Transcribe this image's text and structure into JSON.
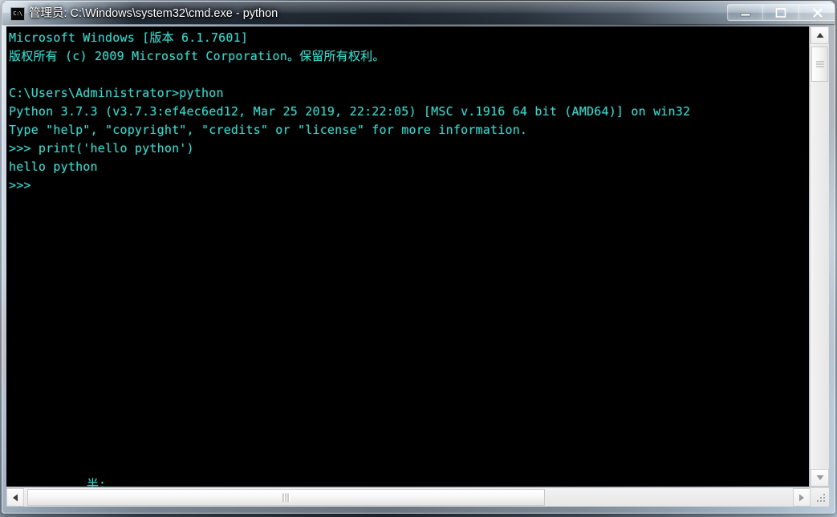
{
  "window": {
    "title": "管理员: C:\\Windows\\system32\\cmd.exe - python",
    "icon_label": "C:\\",
    "icon_name": "cmd-console-icon",
    "controls": {
      "minimize_label": "最小化",
      "maximize_label": "最大化",
      "close_label": "关闭"
    }
  },
  "console": {
    "background_color": "#000000",
    "text_color": "#3ad2c8",
    "lines": [
      "Microsoft Windows [版本 6.1.7601]",
      "版权所有 (c) 2009 Microsoft Corporation。保留所有权利。",
      "",
      "C:\\Users\\Administrator>python",
      "Python 3.7.3 (v3.7.3:ef4ec6ed12, Mar 25 2019, 22:22:05) [MSC v.1916 64 bit (AMD64)] on win32",
      "Type \"help\", \"copyright\", \"credits\" or \"license\" for more information.",
      ">>> print('hello python')",
      "hello python",
      ">>>"
    ],
    "bottom_text": "半:"
  },
  "scrollbars": {
    "vertical": {
      "up_arrow": "▲",
      "down_arrow": "▼",
      "thumb_grip": "grip-lines"
    },
    "horizontal": {
      "left_arrow": "◀",
      "right_arrow": "▶",
      "thumb_grip": "grip-lines"
    }
  }
}
